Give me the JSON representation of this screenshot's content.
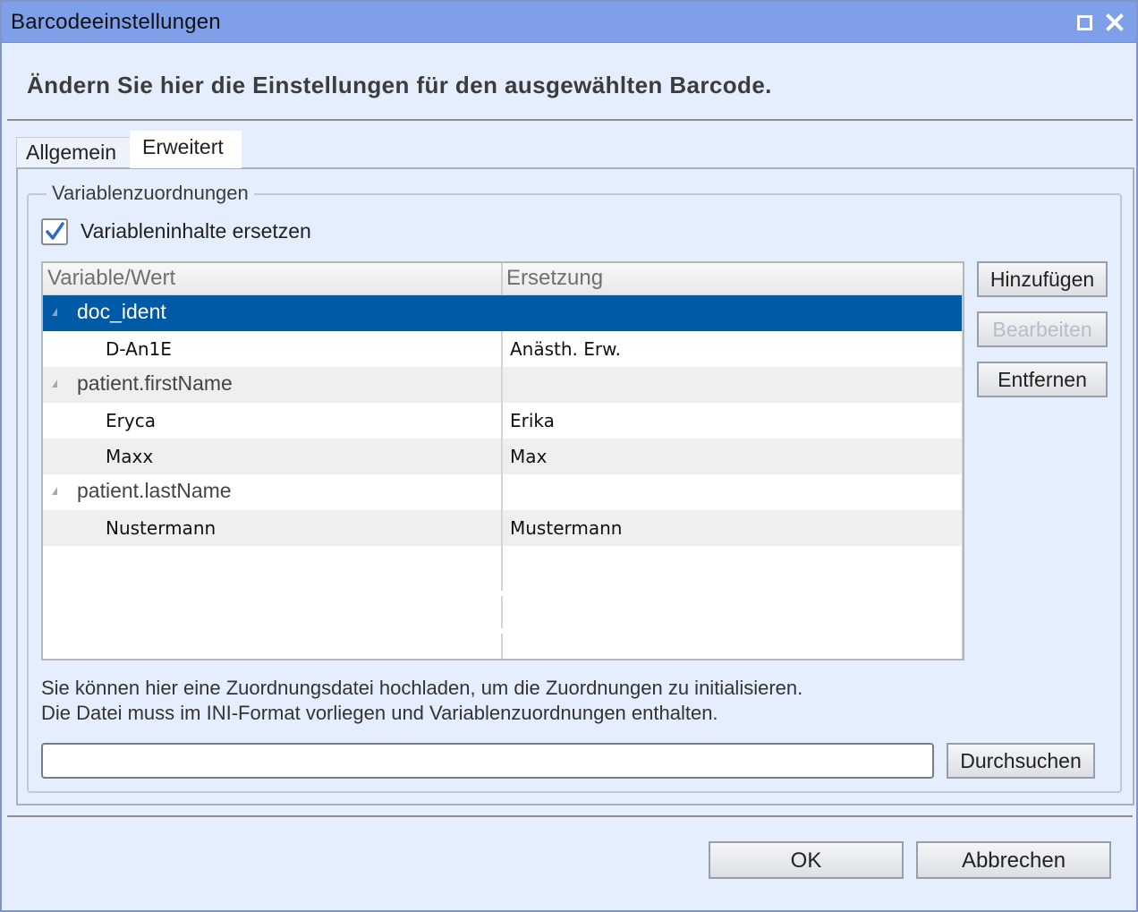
{
  "window": {
    "title": "Barcodeeinstellungen",
    "header": "Ändern Sie hier die Einstellungen für den ausgewählten Barcode."
  },
  "tabs": [
    {
      "label": "Allgemein",
      "active": false
    },
    {
      "label": "Erweitert",
      "active": true
    }
  ],
  "group": {
    "title": "Variablenzuordnungen",
    "checkbox": {
      "label": "Variableninhalte ersetzen",
      "checked": true
    },
    "grid": {
      "columns": [
        "Variable/Wert",
        "Ersetzung"
      ],
      "rows": [
        {
          "type": "group",
          "name": "doc_ident",
          "selected": true
        },
        {
          "type": "leaf",
          "value": "D-An1E",
          "replacement": "Anästh. Erw."
        },
        {
          "type": "group",
          "name": "patient.firstName"
        },
        {
          "type": "leaf",
          "value": "Eryca",
          "replacement": "Erika"
        },
        {
          "type": "leaf",
          "value": "Maxx",
          "replacement": "Max"
        },
        {
          "type": "group",
          "name": "patient.lastName"
        },
        {
          "type": "leaf",
          "value": "Nustermann",
          "replacement": "Mustermann"
        }
      ]
    },
    "buttons": {
      "add": "Hinzufügen",
      "edit": "Bearbeiten",
      "edit_disabled": true,
      "remove": "Entfernen"
    },
    "info_line1": "Sie können hier eine Zuordnungsdatei hochladen, um die Zuordnungen zu initialisieren.",
    "info_line2": "Die Datei muss im INI-Format vorliegen und Variablenzuordnungen enthalten.",
    "file_input_value": "",
    "browse_label": "Durchsuchen"
  },
  "footer": {
    "ok": "OK",
    "cancel": "Abbrechen"
  },
  "colors": {
    "titlebar": "#7fa0e8",
    "selection": "#005aa6",
    "background": "#e5eefc"
  }
}
